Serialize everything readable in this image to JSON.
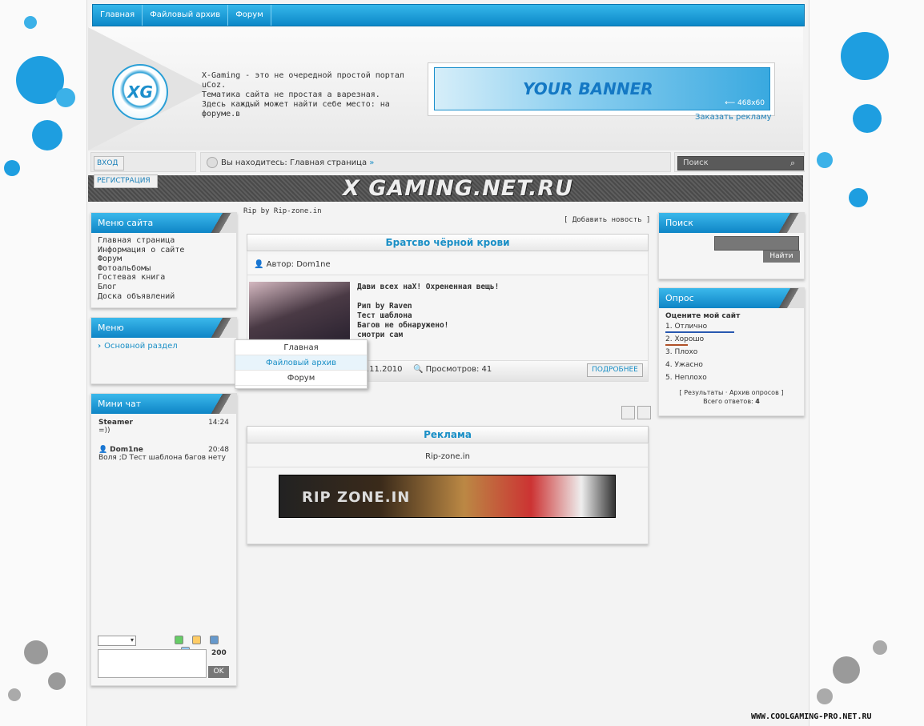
{
  "nav": {
    "items": [
      "Главная",
      "Файловый архив",
      "Форум"
    ]
  },
  "header": {
    "logo_text": "XG",
    "intro_lines": [
      "X-Gaming - это не очередной простой портал uCoz.",
      "Тематика сайта не простая а варезная.",
      "Здесь каждый может найти себе место: на",
      "форуме.в"
    ],
    "banner_text": "YOUR BANNER",
    "banner_size": "468x60",
    "order_ad": "Заказать рекламу"
  },
  "auth": {
    "login": "ВХОД",
    "register": "РЕГИСТРАЦИЯ"
  },
  "breadcrumb": {
    "text": "Вы находитесь: Главная страница",
    "sep": "»"
  },
  "search_top": {
    "placeholder": "Поиск"
  },
  "site_title": "X GAMING.NET.RU",
  "site_menu": {
    "title": "Меню сайта",
    "items": [
      "Главная страница",
      "Информация о сайте",
      "Форум",
      "Фотоальбомы",
      "Гостевая книга",
      "Блог",
      "Доска объявлений"
    ]
  },
  "menu2": {
    "title": "Меню",
    "item": "Основной раздел",
    "dropdown": [
      "Главная",
      "Файловый архив",
      "Форум"
    ]
  },
  "minichat": {
    "title": "Мини чат",
    "messages": [
      {
        "user": "Steamer",
        "time": "14:24",
        "text": "=))"
      },
      {
        "user": "Dom1ne",
        "time": "20:48",
        "text": "Воля ;D Тест шаблона багов нету"
      }
    ],
    "limit": "200",
    "ok": "OK"
  },
  "content": {
    "rip_label": "Rip by Rip-zone.in",
    "add_news": "Добавить новость",
    "post": {
      "title": "Братсво чёрной крови",
      "author_label": "Автор:",
      "author": "Dom1ne",
      "body": [
        "Дави всех наХ! Охрененная вещь!",
        "",
        "Рип by Raven",
        "Тест шаблона",
        "Багов не обнаружено!",
        "смотри сам"
      ],
      "date": ".11.2010",
      "views_label": "Просмотров:",
      "views": "41",
      "more": "ПОДРОБНЕЕ"
    },
    "ad": {
      "title": "Реклама",
      "site": "Rip-zone.in",
      "banner_text": "RIP ZONE.IN"
    }
  },
  "search_panel": {
    "title": "Поиск",
    "button": "Найти"
  },
  "poll": {
    "title": "Опрос",
    "question": "Оцените мой сайт",
    "options": [
      "1. Отлично",
      "2. Хорошо",
      "3. Плохо",
      "4. Ужасно",
      "5. Неплохо"
    ],
    "results": "Результаты",
    "archive": "Архив опросов",
    "total_label": "Всего ответов:",
    "total": "4"
  },
  "watermark": "WWW.COOLGAMING-PRO.NET.RU",
  "colors": {
    "accent": "#1a8fc6",
    "nav_top": "#35b7ea",
    "nav_bottom": "#0c88c8",
    "splat": "#1e9ee0",
    "splat_grey": "#9a9a9a"
  }
}
